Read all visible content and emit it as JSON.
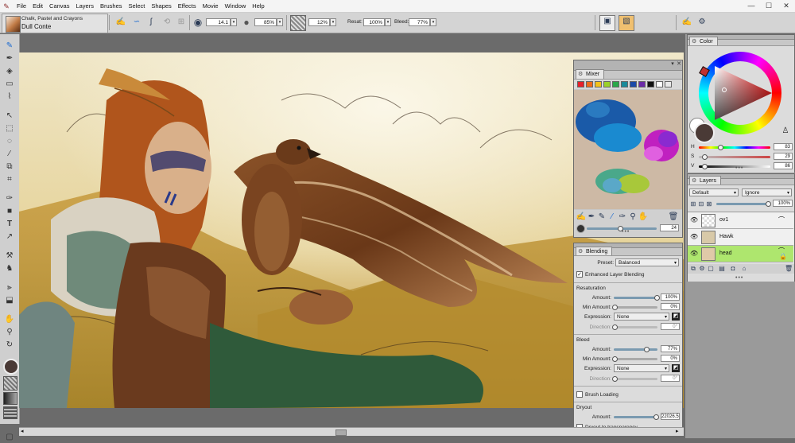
{
  "menu": [
    "File",
    "Edit",
    "Canvas",
    "Layers",
    "Brushes",
    "Select",
    "Shapes",
    "Effects",
    "Movie",
    "Window",
    "Help"
  ],
  "window_controls": {
    "minimize": "—",
    "maximize": "☐",
    "close": "✕"
  },
  "propbar": {
    "brush_category": "Chalk, Pastel and Crayons",
    "brush_variant": "Dull Conte",
    "size_value": "14.1",
    "opacity_value": "85%",
    "grain_value": "12%",
    "resat_label": "Resat:",
    "resat_value": "100%",
    "bleed_label": "Bleed:",
    "bleed_value": "77%"
  },
  "mixer": {
    "title": "Mixer",
    "swatches": [
      "#e8202a",
      "#f06a1a",
      "#f3c21a",
      "#9bd12a",
      "#2aa84a",
      "#1a8a9a",
      "#1a4aa8",
      "#6a2aa8",
      "#111111",
      "#ffffff",
      "#e8e8e8"
    ],
    "brush_size_value": "24"
  },
  "blending": {
    "title": "Blending",
    "preset_label": "Preset:",
    "preset_value": "Balanced",
    "enhanced_label": "Enhanced Layer Blending",
    "enhanced_checked": true,
    "resaturation": {
      "section": "Resaturation",
      "amount_label": "Amount:",
      "amount_value": "100%",
      "amount": 1.0,
      "min_label": "Min Amount:",
      "min_value": "0%",
      "min": 0.0,
      "expression_label": "Expression:",
      "expression_value": "None",
      "direction_label": "Direction:",
      "direction_value": "0°"
    },
    "bleed": {
      "section": "Bleed",
      "amount_label": "Amount:",
      "amount_value": "77%",
      "amount": 0.77,
      "min_label": "Min Amount:",
      "min_value": "0%",
      "min": 0.0,
      "expression_label": "Expression:",
      "expression_value": "None",
      "direction_label": "Direction:",
      "direction_value": "0°"
    },
    "brush_loading_label": "Brush Loading",
    "dryout": {
      "section": "Dryout",
      "amount_label": "Amount:",
      "amount_value": "22026.5",
      "transparency_label": "Dryout to transparency"
    }
  },
  "color": {
    "title": "Color",
    "h_label": "H",
    "h_value": "83",
    "s_label": "S",
    "s_value": "29",
    "v_label": "V",
    "v_value": "86",
    "main_color": "#4a3a36"
  },
  "layers": {
    "title": "Layers",
    "composite_method": "Default",
    "composite_depth": "Ignore",
    "opacity_value": "100%",
    "items": [
      {
        "name": "ov1",
        "selected": false
      },
      {
        "name": "Hawk",
        "selected": false
      },
      {
        "name": "head",
        "selected": true
      }
    ]
  },
  "colors": {
    "accent_selected_layer": "#aee66e",
    "panel_bg": "#c7c7c7"
  }
}
